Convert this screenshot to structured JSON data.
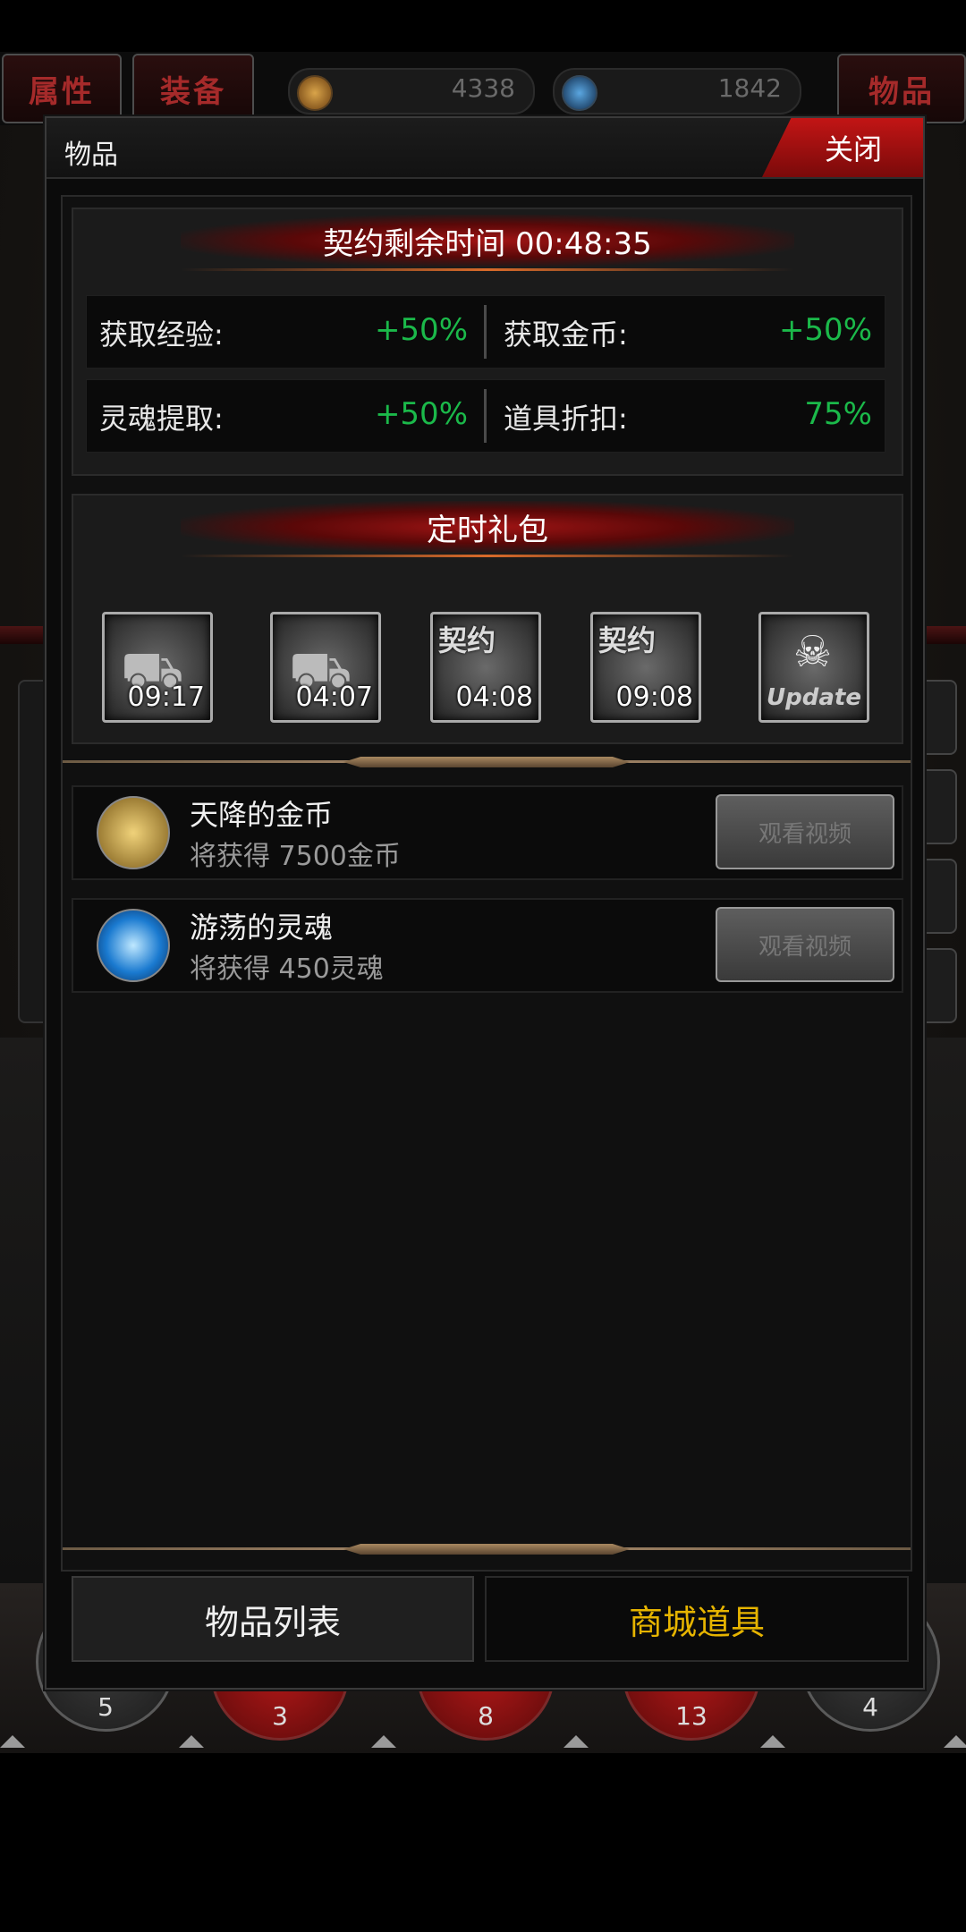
{
  "topbar": {
    "tab_attributes": "属性",
    "tab_equipment": "装备",
    "tab_items": "物品",
    "currency1_value": "4338",
    "currency2_value": "1842"
  },
  "modal": {
    "title": "物品",
    "close_label": "关闭",
    "contract": {
      "banner": "契约剩余时间 00:48:35",
      "stats": [
        {
          "label": "获取经验:",
          "value": "+50%"
        },
        {
          "label": "获取金币:",
          "value": "+50%"
        },
        {
          "label": "灵魂提取:",
          "value": "+50%"
        },
        {
          "label": "道具折扣:",
          "value": "75%"
        }
      ]
    },
    "gifts": {
      "banner": "定时礼包",
      "items": [
        {
          "time": "09:17",
          "tag": ""
        },
        {
          "time": "04:07",
          "tag": ""
        },
        {
          "time": "04:08",
          "tag": "契约"
        },
        {
          "time": "09:08",
          "tag": "契约"
        },
        {
          "time": "",
          "tag": "Update"
        }
      ]
    },
    "rewards": [
      {
        "name": "天降的金币",
        "desc": "将获得 7500金币",
        "button": "观看视频",
        "icon": "gold-coins-icon"
      },
      {
        "name": "游荡的灵魂",
        "desc": "将获得 450灵魂",
        "button": "观看视频",
        "icon": "soul-orb-icon"
      }
    ],
    "bottom_tabs": {
      "item_list": "物品列表",
      "shop_items": "商城道具"
    }
  },
  "background": {
    "circles": [
      {
        "label": "5"
      },
      {
        "label": "3"
      },
      {
        "label": "8"
      },
      {
        "label": "13"
      },
      {
        "label": "4"
      }
    ]
  },
  "colors": {
    "accent_red": "#c21515",
    "positive_green": "#1bb94a",
    "shop_tab_gold": "#e6b400"
  }
}
